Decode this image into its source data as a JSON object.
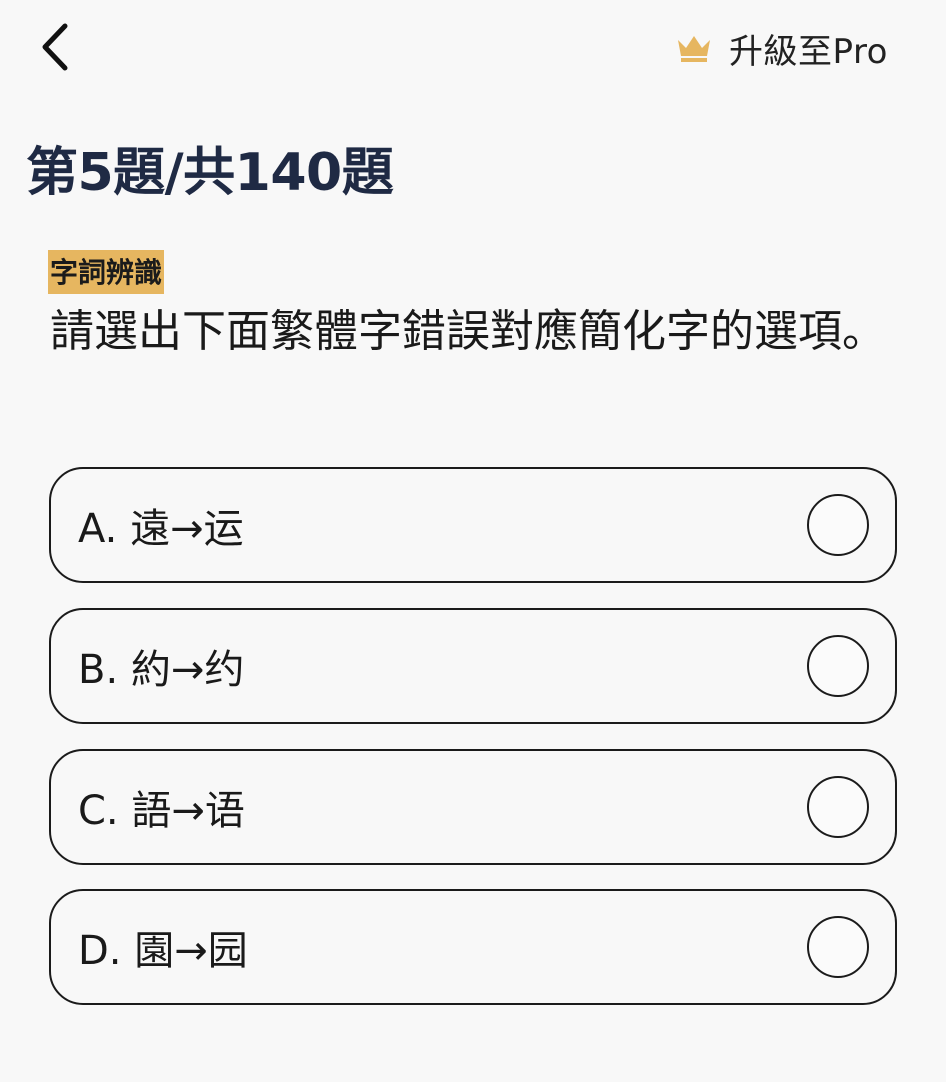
{
  "header": {
    "back_icon": "chevron-left-icon",
    "upgrade_icon": "crown-icon",
    "upgrade_label": "升級至Pro",
    "accent_color": "#e6b660"
  },
  "progress": {
    "title": "第5題/共140題"
  },
  "question": {
    "category": "字詞辨識",
    "text": "請選出下面繁體字錯誤對應簡化字的選項。"
  },
  "options": [
    {
      "label": "A. 遠→运"
    },
    {
      "label": "B. 約→约"
    },
    {
      "label": "C. 語→语"
    },
    {
      "label": "D. 園→园"
    }
  ]
}
